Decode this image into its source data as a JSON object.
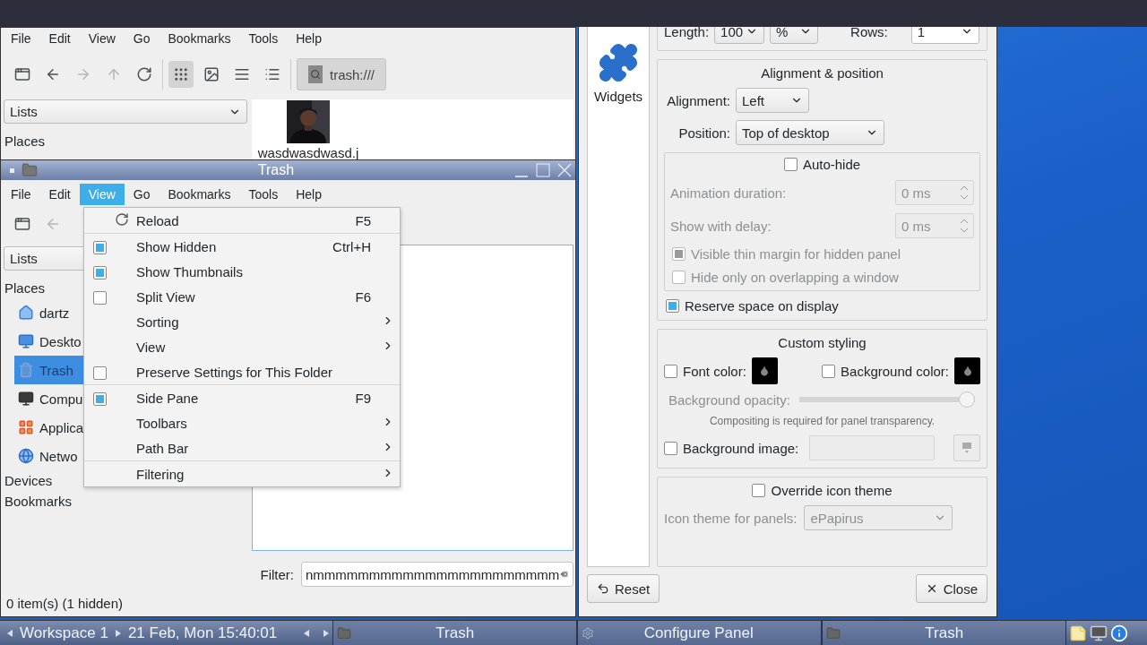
{
  "back_window": {
    "menu": [
      "File",
      "Edit",
      "View",
      "Go",
      "Bookmarks",
      "Tools",
      "Help"
    ],
    "nav": [
      {
        "kind": "new",
        "disabled": false
      },
      {
        "kind": "back",
        "disabled": false
      },
      {
        "kind": "forward",
        "disabled": true
      },
      {
        "kind": "up",
        "disabled": true
      },
      {
        "kind": "reload",
        "disabled": false
      }
    ],
    "view_modes": [
      {
        "kind": "icons",
        "selected": true
      },
      {
        "kind": "thumbnails",
        "selected": false
      },
      {
        "kind": "compact",
        "selected": false
      },
      {
        "kind": "list",
        "selected": false
      }
    ],
    "location": "trash:///",
    "side_combo": "Lists",
    "places_heading": "Places",
    "file": {
      "name": "wasdwasdwasd.j",
      "kind": "picture"
    }
  },
  "trash_window": {
    "title": "Trash",
    "menu": [
      {
        "label": "File",
        "selected": false
      },
      {
        "label": "Edit",
        "selected": false
      },
      {
        "label": "View",
        "selected": true
      },
      {
        "label": "Go",
        "selected": false
      },
      {
        "label": "Bookmarks",
        "selected": false
      },
      {
        "label": "Tools",
        "selected": false
      },
      {
        "label": "Help",
        "selected": false
      }
    ],
    "side_combo": "Lists",
    "places_heading": "Places",
    "places": [
      {
        "label": "dartz",
        "kind": "home",
        "selected": false
      },
      {
        "label": "Deskto",
        "kind": "desktop",
        "selected": false
      },
      {
        "label": "Trash",
        "kind": "trash",
        "selected": true
      },
      {
        "label": "Compu",
        "kind": "computer",
        "selected": false
      },
      {
        "label": "Applica",
        "kind": "apps",
        "selected": false
      },
      {
        "label": "Netwo",
        "kind": "network",
        "selected": false
      }
    ],
    "sections": [
      "Devices",
      "Bookmarks"
    ],
    "filter_label": "Filter:",
    "filter_value": "nmmmmmmmmmmmmmmmmmmmmmm",
    "status": "0 item(s) (1 hidden)"
  },
  "view_menu": [
    [
      {
        "kind": "action",
        "label": "Reload",
        "shortcut": "F5"
      }
    ],
    [
      {
        "kind": "check",
        "label": "Show Hidden",
        "checked": true,
        "shortcut": "Ctrl+H"
      },
      {
        "kind": "check",
        "label": "Show Thumbnails",
        "checked": true
      },
      {
        "kind": "check",
        "label": "Split View",
        "checked": false,
        "shortcut": "F6"
      },
      {
        "kind": "submenu",
        "label": "Sorting"
      },
      {
        "kind": "submenu",
        "label": "View"
      },
      {
        "kind": "check",
        "label": "Preserve Settings for This Folder",
        "checked": false
      }
    ],
    [
      {
        "kind": "check",
        "label": "Side Pane",
        "checked": true,
        "shortcut": "F9"
      },
      {
        "kind": "submenu",
        "label": "Toolbars"
      },
      {
        "kind": "submenu",
        "label": "Path Bar"
      }
    ],
    [
      {
        "kind": "submenu",
        "label": "Filtering"
      }
    ]
  ],
  "config": {
    "sidebar_label": "Widgets",
    "size": {
      "length_label": "Length:",
      "length_value": "100",
      "unit": "%",
      "rows_label": "Rows:",
      "rows_value": "1"
    },
    "alignment": {
      "title": "Alignment & position",
      "alignment_label": "Alignment:",
      "alignment_value": "Left",
      "position_label": "Position:",
      "position_value": "Top of desktop",
      "autohide": {
        "label": "Auto-hide",
        "checked": false
      },
      "animation_label": "Animation duration:",
      "animation_value": "0 ms",
      "delay_label": "Show with delay:",
      "delay_value": "0 ms",
      "thin_margin": {
        "label": "Visible thin margin for hidden panel",
        "checked": true,
        "disabled": true
      },
      "overlap": {
        "label": "Hide only on overlapping a window",
        "checked": false,
        "disabled": true
      },
      "reserve": {
        "label": "Reserve space on display",
        "checked": true
      }
    },
    "styling": {
      "title": "Custom styling",
      "font_color": {
        "label": "Font color:",
        "checked": false
      },
      "bg_color": {
        "label": "Background color:",
        "checked": false
      },
      "opacity_label": "Background opacity:",
      "opacity": {
        "level": 1
      },
      "note": "Compositing is required for panel transparency.",
      "bg_image": {
        "label": "Background image:",
        "checked": false
      }
    },
    "icon_theme": {
      "override": {
        "label": "Override icon theme",
        "checked": false
      },
      "label": "Icon theme for panels:",
      "value": "ePapirus"
    },
    "buttons": [
      {
        "kind": "reset",
        "label": "Reset"
      },
      {
        "kind": "close",
        "label": "Close"
      }
    ]
  },
  "taskbar": {
    "workspace": "Workspace 1",
    "clock": "21 Feb, Mon 15:40:01",
    "tasks": [
      {
        "label": "Trash",
        "kind": "folder"
      },
      {
        "label": "Configure Panel",
        "kind": "settings"
      },
      {
        "label": "Trash",
        "kind": "folder"
      }
    ]
  }
}
